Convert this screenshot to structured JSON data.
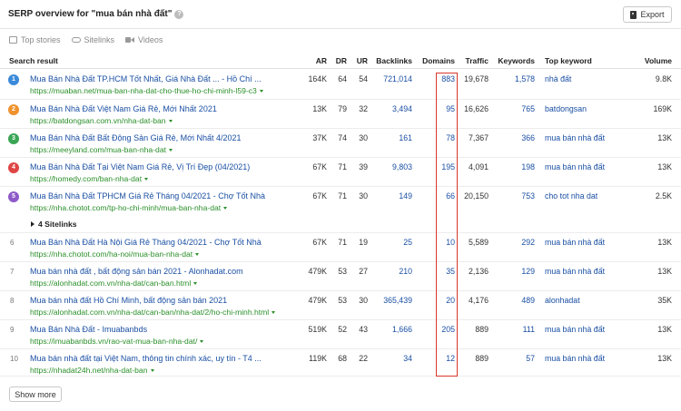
{
  "header": {
    "title": "SERP overview for \"mua bán nhà đất\"",
    "help": "?",
    "export_label": "Export"
  },
  "features": [
    {
      "label": "Top stories"
    },
    {
      "label": "Sitelinks"
    },
    {
      "label": "Videos"
    }
  ],
  "columns": {
    "result": "Search result",
    "ar": "AR",
    "dr": "DR",
    "ur": "UR",
    "backlinks": "Backlinks",
    "domains": "Domains",
    "traffic": "Traffic",
    "keywords": "Keywords",
    "top_keyword": "Top keyword",
    "volume": "Volume"
  },
  "rows": [
    {
      "pos": "1",
      "color": "#3b8ad9",
      "title": "Mua Bán Nhà Đất TP.HCM Tốt Nhất, Giá Nhà Đất ... - Hồ Chí ...",
      "url": "https://muaban.net/mua-ban-nha-dat-cho-thue-ho-chi-minh-l59-c3",
      "ar": "164K",
      "dr": "64",
      "ur": "54",
      "backlinks": "721,014",
      "domains": "883",
      "traffic": "19,678",
      "keywords": "1,578",
      "top_keyword": "nhà đất",
      "volume": "9.8K"
    },
    {
      "pos": "2",
      "color": "#f0922e",
      "title": "Mua Bán Nhà Đất Việt Nam Giá Rẻ, Mới Nhất 2021",
      "url": "https://batdongsan.com.vn/nha-dat-ban",
      "ar": "13K",
      "dr": "79",
      "ur": "32",
      "backlinks": "3,494",
      "domains": "95",
      "traffic": "16,626",
      "keywords": "765",
      "top_keyword": "batdongsan",
      "volume": "169K"
    },
    {
      "pos": "3",
      "color": "#3aa655",
      "title": "Mua Bán Nhà Đất Bất Động Sản Giá Rẻ, Mới Nhất 4/2021",
      "url": "https://meeyland.com/mua-ban-nha-dat",
      "ar": "37K",
      "dr": "74",
      "ur": "30",
      "backlinks": "161",
      "domains": "78",
      "traffic": "7,367",
      "keywords": "366",
      "top_keyword": "mua bán nhà đất",
      "volume": "13K"
    },
    {
      "pos": "4",
      "color": "#e04545",
      "title": "Mua Bán Nhà Đất Tại Việt Nam Giá Rẻ, Vị Trí Đẹp (04/2021)",
      "url": "https://homedy.com/ban-nha-dat",
      "ar": "67K",
      "dr": "71",
      "ur": "39",
      "backlinks": "9,803",
      "domains": "195",
      "traffic": "4,091",
      "keywords": "198",
      "top_keyword": "mua bán nhà đất",
      "volume": "13K"
    },
    {
      "pos": "5",
      "color": "#8e5ac9",
      "title": "Mua Bán Nhà Đất TPHCM Giá Rẻ Tháng 04/2021 - Chợ Tốt Nhà",
      "url": "https://nha.chotot.com/tp-ho-chi-minh/mua-ban-nha-dat",
      "ar": "67K",
      "dr": "71",
      "ur": "30",
      "backlinks": "149",
      "domains": "66",
      "traffic": "20,150",
      "keywords": "753",
      "top_keyword": "cho tot nha dat",
      "volume": "2.5K",
      "sitelinks": "4 Sitelinks"
    },
    {
      "pos": "6",
      "title": "Mua Bán Nhà Đất Hà Nội Giá Rẻ Tháng 04/2021 - Chợ Tốt Nhà",
      "url": "https://nha.chotot.com/ha-noi/mua-ban-nha-dat",
      "ar": "67K",
      "dr": "71",
      "ur": "19",
      "backlinks": "25",
      "domains": "10",
      "traffic": "5,589",
      "keywords": "292",
      "top_keyword": "mua bán nhà đất",
      "volume": "13K"
    },
    {
      "pos": "7",
      "title": "Mua bán nhà đất , bất động sản bán 2021 - Alonhadat.com",
      "url": "https://alonhadat.com.vn/nha-dat/can-ban.html",
      "ar": "479K",
      "dr": "53",
      "ur": "27",
      "backlinks": "210",
      "domains": "35",
      "traffic": "2,136",
      "keywords": "129",
      "top_keyword": "mua bán nhà đất",
      "volume": "13K"
    },
    {
      "pos": "8",
      "title": "Mua bán nhà đất Hồ Chí Minh, bất động sản bán 2021",
      "url": "https://alonhadat.com.vn/nha-dat/can-ban/nha-dat/2/ho-chi-minh.html",
      "ar": "479K",
      "dr": "53",
      "ur": "30",
      "backlinks": "365,439",
      "domains": "20",
      "traffic": "4,176",
      "keywords": "489",
      "top_keyword": "alonhadat",
      "volume": "35K"
    },
    {
      "pos": "9",
      "title": "Mua Bán Nhà Đất - Imuabanbds",
      "url": "https://imuabanbds.vn/rao-vat-mua-ban-nha-dat/",
      "ar": "519K",
      "dr": "52",
      "ur": "43",
      "backlinks": "1,666",
      "domains": "205",
      "traffic": "889",
      "keywords": "111",
      "top_keyword": "mua bán nhà đất",
      "volume": "13K"
    },
    {
      "pos": "10",
      "title": "Mua bán nhà đất tại Việt Nam, thông tin chính xác, uy tín - T4 ...",
      "url": "https://nhadat24h.net/nha-dat-ban",
      "ar": "119K",
      "dr": "68",
      "ur": "22",
      "backlinks": "34",
      "domains": "12",
      "traffic": "889",
      "keywords": "57",
      "top_keyword": "mua bán nhà đất",
      "volume": "13K"
    }
  ],
  "footer": {
    "show_more_label": "Show more"
  }
}
